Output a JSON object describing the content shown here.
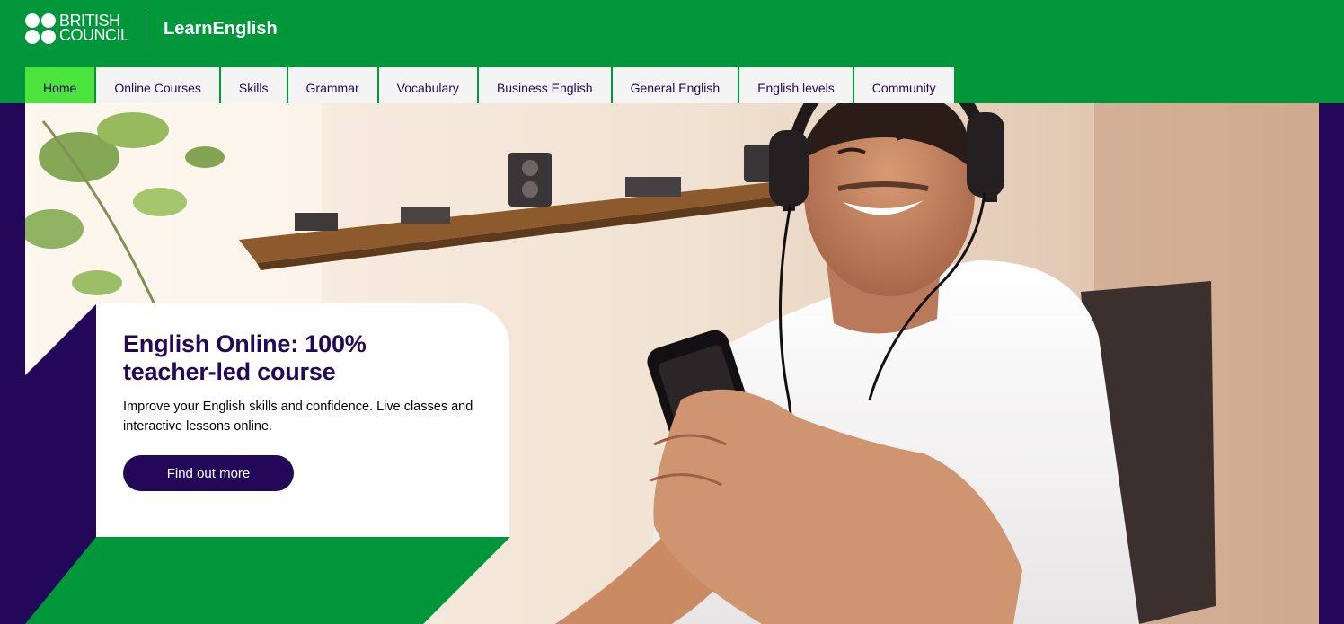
{
  "brand": {
    "logo_line1": "BRITISH",
    "logo_line2": "COUNCIL",
    "site_name": "LearnEnglish"
  },
  "nav": {
    "items": [
      {
        "label": "Home",
        "active": true
      },
      {
        "label": "Online Courses"
      },
      {
        "label": "Skills"
      },
      {
        "label": "Grammar"
      },
      {
        "label": "Vocabulary"
      },
      {
        "label": "Business English"
      },
      {
        "label": "General English"
      },
      {
        "label": "English levels"
      },
      {
        "label": "Community"
      }
    ]
  },
  "hero": {
    "title_line1": "English Online: 100%",
    "title_line2": "teacher-led course",
    "description": "Improve your English skills and confidence. Live classes and interactive lessons online.",
    "button_label": "Find out more"
  },
  "colors": {
    "brand_green": "#00973a",
    "active_green": "#4ae43c",
    "brand_purple": "#23085a"
  }
}
